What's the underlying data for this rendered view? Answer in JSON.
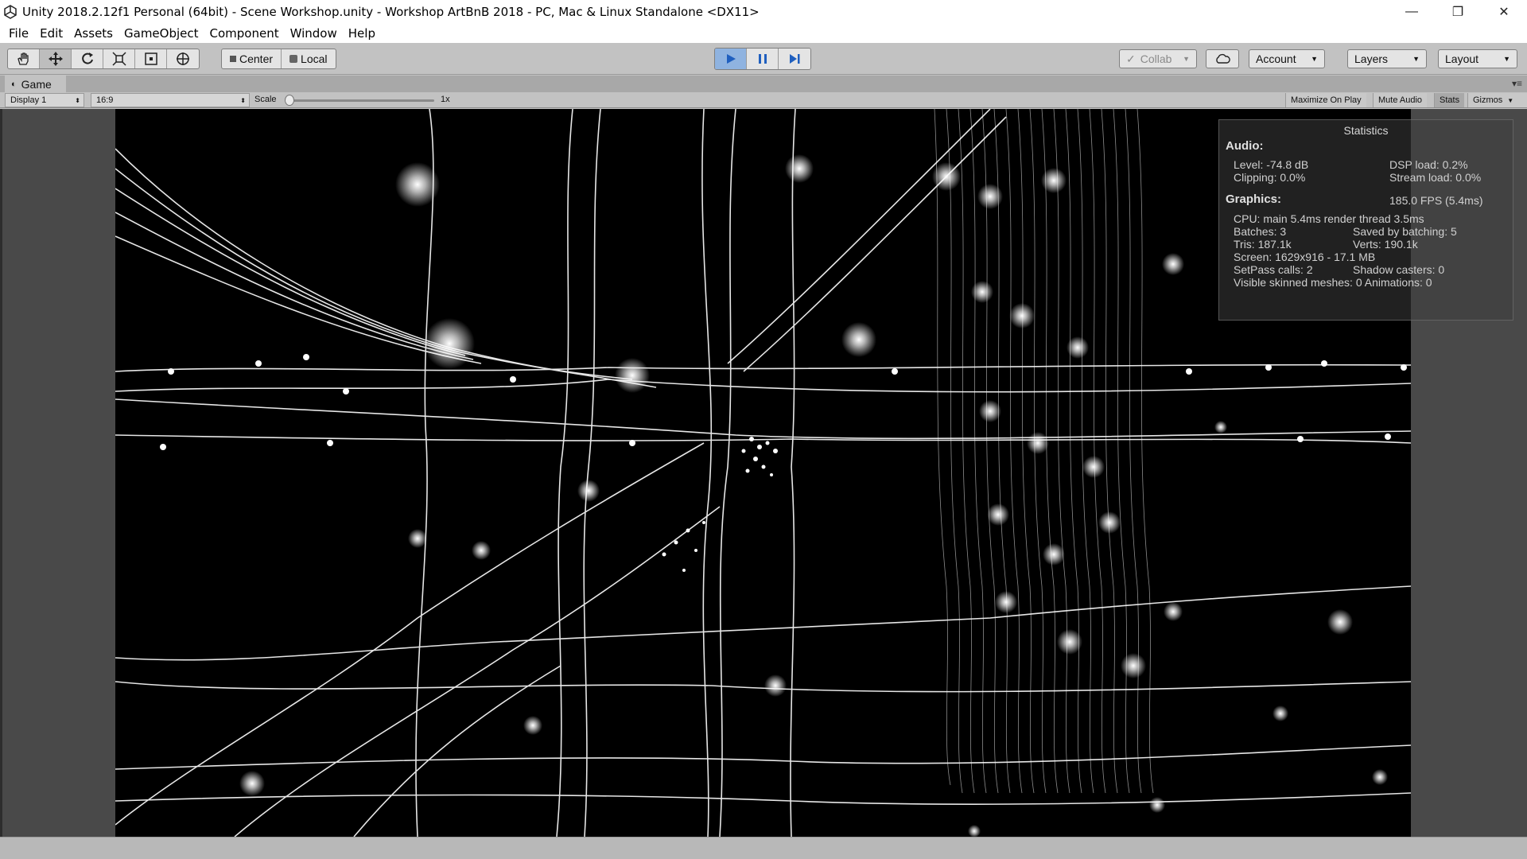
{
  "window": {
    "title": "Unity 2018.2.12f1 Personal (64bit) - Scene Workshop.unity - Workshop ArtBnB 2018 - PC, Mac & Linux Standalone <DX11>",
    "minimize": "—",
    "maximize": "❐",
    "close": "✕"
  },
  "menu": [
    "File",
    "Edit",
    "Assets",
    "GameObject",
    "Component",
    "Window",
    "Help"
  ],
  "toolbar": {
    "tools": [
      "hand-icon",
      "move-icon",
      "rotate-icon",
      "scale-icon",
      "rect-icon",
      "transform-icon"
    ],
    "pivot": "Center",
    "space": "Local",
    "collab": "Collab",
    "account": "Account",
    "layers": "Layers",
    "layout": "Layout"
  },
  "tab": {
    "label": "Game"
  },
  "gamebar": {
    "display": "Display 1",
    "aspect": "16:9",
    "scale_label": "Scale",
    "scale_value": "1x",
    "maximize": "Maximize On Play",
    "mute": "Mute Audio",
    "stats": "Stats",
    "gizmos": "Gizmos"
  },
  "stats": {
    "title": "Statistics",
    "audio_head": "Audio:",
    "level": "Level: -74.8 dB",
    "dsp": "DSP load: 0.2%",
    "clipping": "Clipping: 0.0%",
    "stream": "Stream load: 0.0%",
    "graphics_head": "Graphics:",
    "fps": "185.0 FPS (5.4ms)",
    "cpu": "CPU: main 5.4ms  render thread 3.5ms",
    "batches": "Batches: 3",
    "saved": "Saved by batching: 5",
    "tris": "Tris: 187.1k",
    "verts": "Verts: 190.1k",
    "screen": "Screen: 1629x916 - 17.1 MB",
    "setpass": "SetPass calls: 2",
    "shadow": "Shadow casters: 0",
    "skinned": "Visible skinned meshes: 0  Animations: 0"
  },
  "colors": {
    "play_active": "#8fb3e0",
    "editor_bg": "#c2c2c2",
    "game_bg": "#000000"
  }
}
